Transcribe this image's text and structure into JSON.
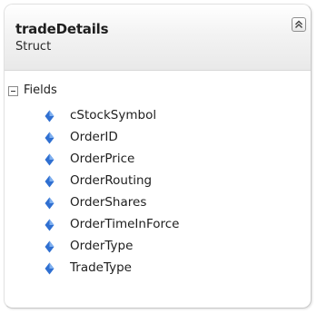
{
  "class_shape": {
    "title": "tradeDetails",
    "kind": "Struct",
    "collapse_icon": "double-chevron-up-icon"
  },
  "fields_section": {
    "label": "Fields",
    "expander_icon": "collapse-minus-icon",
    "field_icon": "field-diamond-icon",
    "items": [
      "cStockSymbol",
      "OrderID",
      "OrderPrice",
      "OrderRouting",
      "OrderShares",
      "OrderTimeInForce",
      "OrderType",
      "TradeType"
    ]
  },
  "colors": {
    "field_icon": "#2f6fd1",
    "border": "#c9c9c9"
  }
}
